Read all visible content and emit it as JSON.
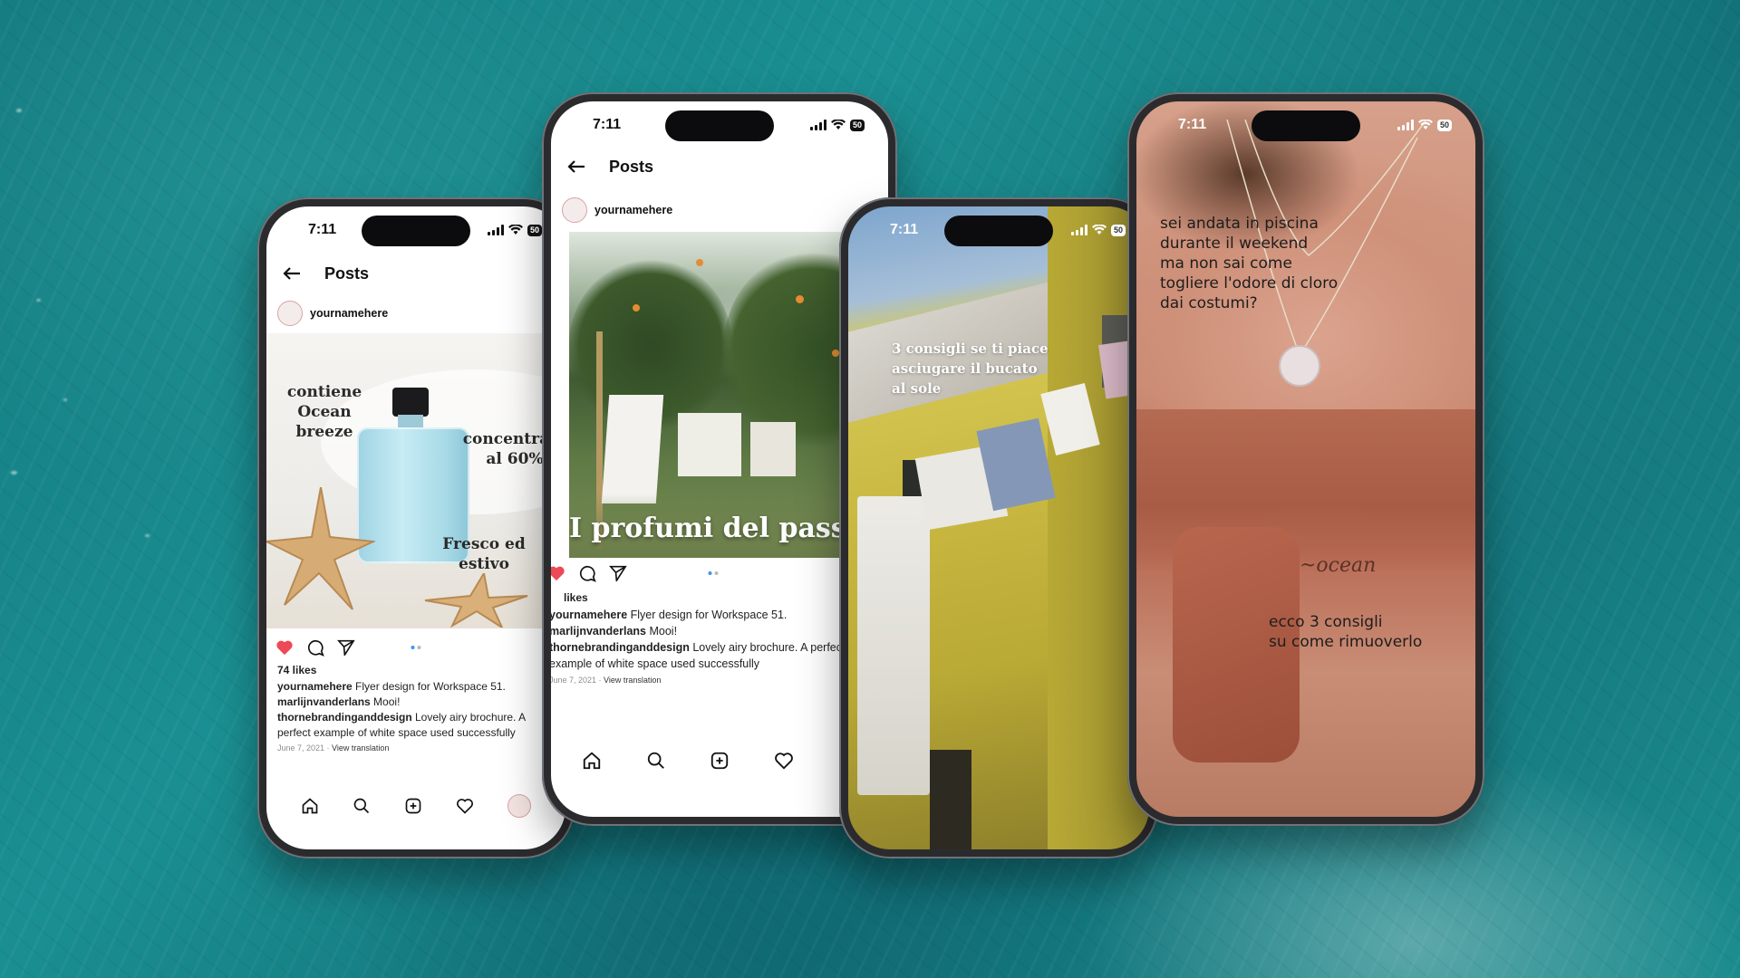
{
  "phone1": {
    "time": "7:11",
    "battery": "50",
    "header_title": "Posts",
    "username": "yournamehere",
    "image_caption_1a": "contiene",
    "image_caption_1b": "Ocean breeze",
    "image_caption_2a": "concentrato",
    "image_caption_2b": "al 60%",
    "image_caption_3a": "Fresco ed",
    "image_caption_3b": "estivo",
    "likes": "74 likes",
    "comments": [
      {
        "user": "yournamehere",
        "text": " Flyer design for Workspace 51."
      },
      {
        "user": "marlijnvanderlans",
        "text": " Mooi!"
      },
      {
        "user": "thornebrandinganddesign",
        "text": " Lovely airy brochure. A perfect example of white space used successfully"
      }
    ],
    "date": "June 7, 2021 · ",
    "view_translation": "View translation"
  },
  "phone2": {
    "time": "7:11",
    "battery": "50",
    "header_title": "Posts",
    "username": "yournamehere",
    "image_title": "I profumi del passato",
    "likes": " likes",
    "comments": [
      {
        "user": "yournamehere",
        "text": " Flyer design for Workspace 51."
      },
      {
        "user": "marlijnvanderlans",
        "text": " Mooi!"
      },
      {
        "user": "thornebrandinganddesign",
        "text": " Lovely airy brochure. A perfect example of white space used successfully"
      }
    ],
    "date": "June 7, 2021 · ",
    "view_translation": "View translation"
  },
  "phone3": {
    "time": "7:11",
    "battery": "50",
    "story_text_lines": [
      "3 consigli se ti piace",
      "asciugare il bucato",
      "al sole"
    ]
  },
  "phone4": {
    "time": "7:11",
    "battery": "50",
    "story_text_top_lines": [
      "sei andata in piscina",
      "durante il weekend",
      "ma non sai come",
      "togliere l'odore di cloro",
      "dai costumi?"
    ],
    "story_text_bottom_lines": [
      "ecco 3 consigli",
      "su come rimuoverlo"
    ]
  },
  "colors": {
    "background_sea": "#137a80",
    "heart_red": "#ed4956",
    "dots_blue": "#3897f0"
  }
}
